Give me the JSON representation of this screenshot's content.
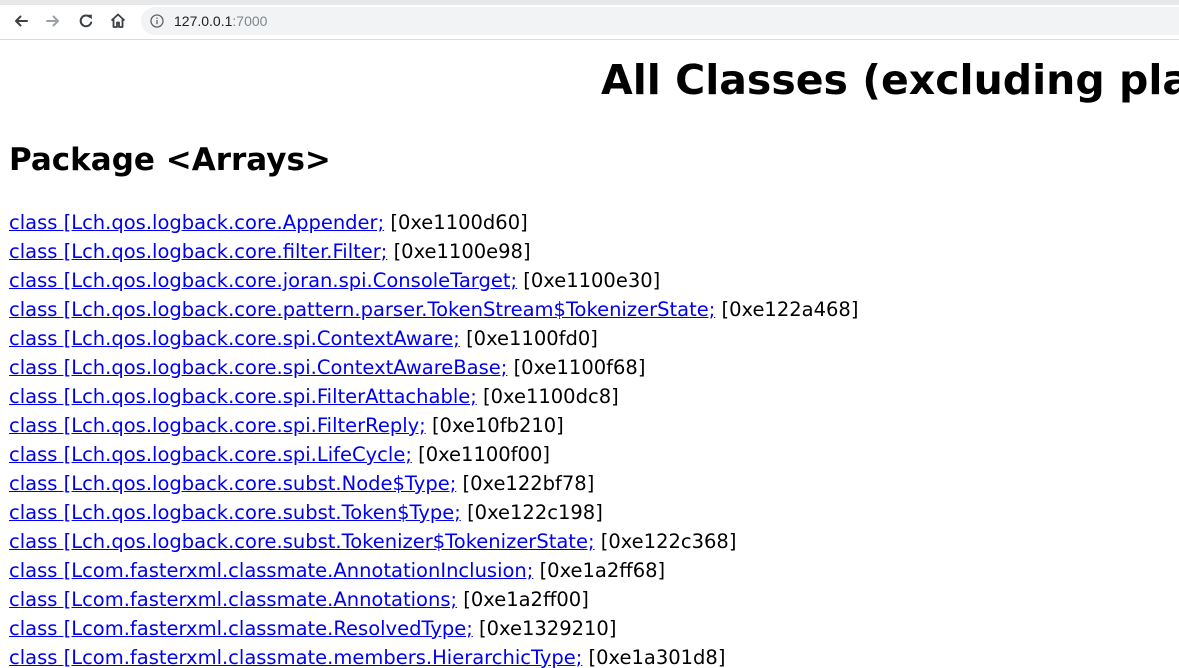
{
  "browser": {
    "url_host": "127.0.0.1",
    "url_port": ":7000",
    "icons": {
      "back": "back-arrow-icon",
      "forward": "forward-arrow-icon",
      "reload": "reload-icon",
      "home": "home-icon",
      "site_info": "info-icon"
    }
  },
  "page": {
    "title": "All Classes (excluding platf",
    "package_heading": "Package <Arrays>",
    "link_color": "#0000ee",
    "classes": [
      {
        "name": "class [Lch.qos.logback.core.Appender;",
        "addr": "[0xe1100d60]"
      },
      {
        "name": "class [Lch.qos.logback.core.filter.Filter;",
        "addr": "[0xe1100e98]"
      },
      {
        "name": "class [Lch.qos.logback.core.joran.spi.ConsoleTarget;",
        "addr": "[0xe1100e30]"
      },
      {
        "name": "class [Lch.qos.logback.core.pattern.parser.TokenStream$TokenizerState;",
        "addr": "[0xe122a468]"
      },
      {
        "name": "class [Lch.qos.logback.core.spi.ContextAware;",
        "addr": "[0xe1100fd0]"
      },
      {
        "name": "class [Lch.qos.logback.core.spi.ContextAwareBase;",
        "addr": "[0xe1100f68]"
      },
      {
        "name": "class [Lch.qos.logback.core.spi.FilterAttachable;",
        "addr": "[0xe1100dc8]"
      },
      {
        "name": "class [Lch.qos.logback.core.spi.FilterReply;",
        "addr": "[0xe10fb210]"
      },
      {
        "name": "class [Lch.qos.logback.core.spi.LifeCycle;",
        "addr": "[0xe1100f00]"
      },
      {
        "name": "class [Lch.qos.logback.core.subst.Node$Type;",
        "addr": "[0xe122bf78]"
      },
      {
        "name": "class [Lch.qos.logback.core.subst.Token$Type;",
        "addr": "[0xe122c198]"
      },
      {
        "name": "class [Lch.qos.logback.core.subst.Tokenizer$TokenizerState;",
        "addr": "[0xe122c368]"
      },
      {
        "name": "class [Lcom.fasterxml.classmate.AnnotationInclusion;",
        "addr": "[0xe1a2ff68]"
      },
      {
        "name": "class [Lcom.fasterxml.classmate.Annotations;",
        "addr": "[0xe1a2ff00]"
      },
      {
        "name": "class [Lcom.fasterxml.classmate.ResolvedType;",
        "addr": "[0xe1329210]"
      },
      {
        "name": "class [Lcom.fasterxml.classmate.members.HierarchicType;",
        "addr": "[0xe1a301d8]"
      }
    ]
  }
}
